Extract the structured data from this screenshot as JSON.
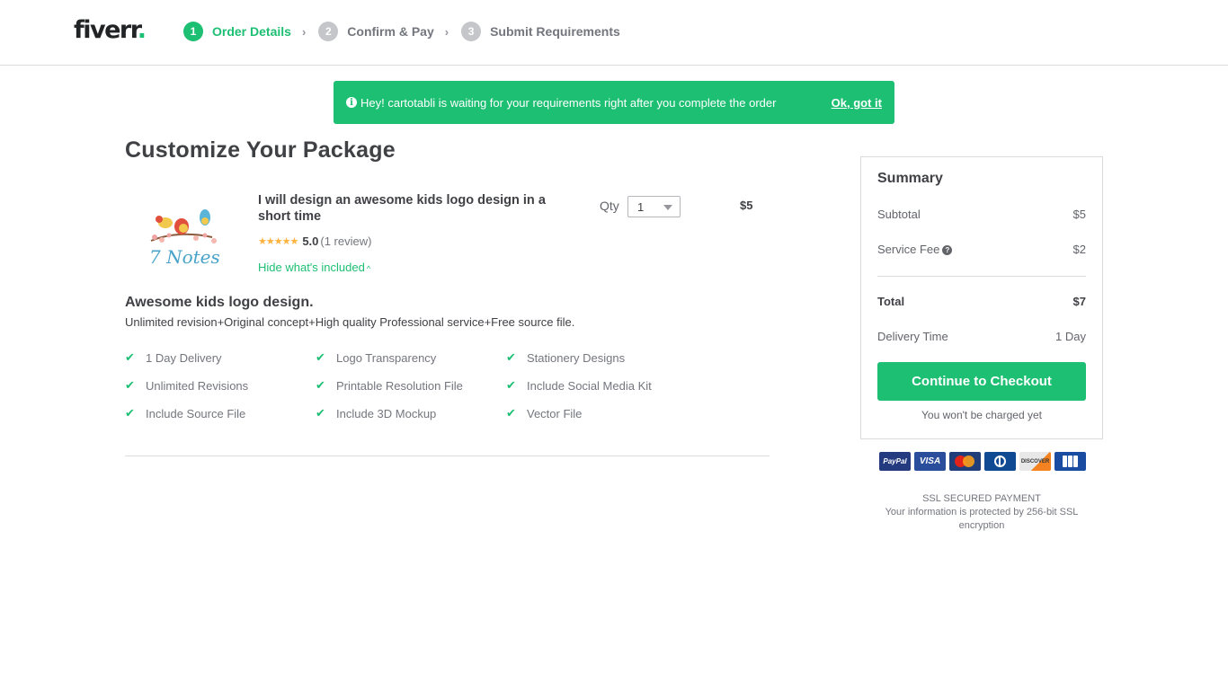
{
  "header": {
    "logo_text": "fiverr",
    "logo_dot": ".",
    "steps": [
      {
        "number": "1",
        "label": "Order Details",
        "active": true
      },
      {
        "number": "2",
        "label": "Confirm & Pay",
        "active": false
      },
      {
        "number": "3",
        "label": "Submit Requirements",
        "active": false
      }
    ],
    "step_separator": "›"
  },
  "banner": {
    "icon": "info-icon",
    "icon_glyph": "i",
    "message": "Hey! cartotabli is waiting for your requirements right after you complete the order",
    "dismiss_label": "Ok, got it"
  },
  "main": {
    "page_title": "Customize Your Package",
    "gig": {
      "image_alt": "7 Notes",
      "title": "I will design an awesome kids logo design in a short time",
      "stars": "★★★★★",
      "rating": "5.0",
      "reviews": "(1 review)",
      "toggle_label": "Hide what's included",
      "toggle_caret": "^"
    },
    "qty": {
      "label": "Qty",
      "value": "1"
    },
    "line_price": "$5",
    "package": {
      "title": "Awesome kids logo design.",
      "description": "Unlimited revision+Original concept+High quality Professional service+Free source file.",
      "check_glyph": "✔",
      "features": [
        "1 Day Delivery",
        "Logo Transparency",
        "Stationery Designs",
        "Unlimited Revisions",
        "Printable Resolution File",
        "Include Social Media Kit",
        "Include Source File",
        "Include 3D Mockup",
        "Vector File"
      ]
    }
  },
  "summary": {
    "title": "Summary",
    "subtotal_label": "Subtotal",
    "subtotal_value": "$5",
    "service_fee_label": "Service Fee",
    "service_fee_help": "?",
    "service_fee_value": "$2",
    "total_label": "Total",
    "total_value": "$7",
    "delivery_label": "Delivery Time",
    "delivery_value": "1 Day",
    "checkout_label": "Continue to Checkout",
    "not_charged": "You won't be charged yet"
  },
  "payments": {
    "methods": [
      "PayPal",
      "VISA",
      "MasterCard",
      "Diners Club",
      "DISCOVER",
      "JCB"
    ]
  },
  "ssl": {
    "title": "SSL SECURED PAYMENT",
    "text": "Your information is protected by 256-bit SSL encryption"
  },
  "colors": {
    "brand_green": "#1dbf73",
    "text_dark": "#404145",
    "text_muted": "#74767e",
    "star": "#ffb33e"
  }
}
